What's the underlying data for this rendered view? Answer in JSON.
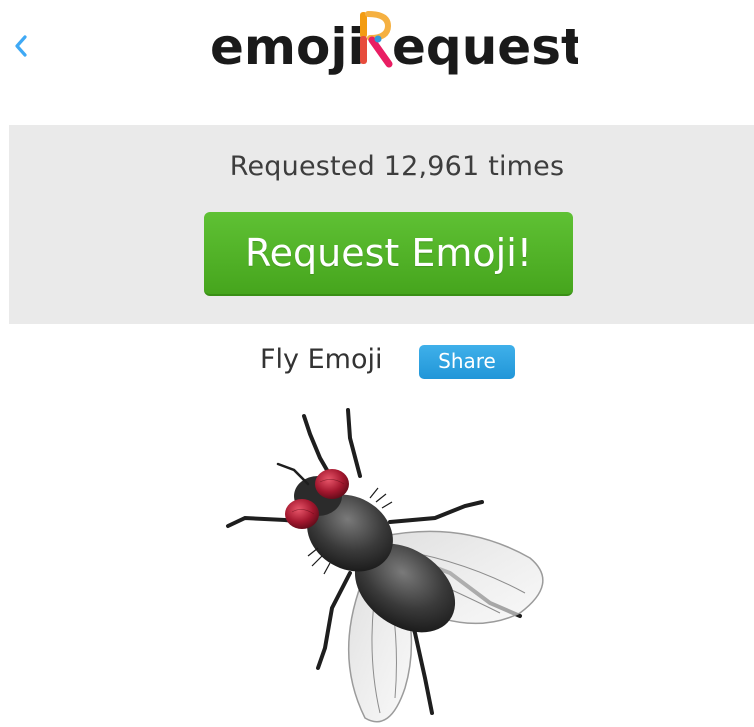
{
  "header": {
    "back_icon": "chevron-left-icon",
    "logo": {
      "part1": "emoji",
      "part2": "equest",
      "colors": {
        "text": "#1a1a1a",
        "r_orange": "#f39c12",
        "r_red": "#e74c3c",
        "r_pink": "#e91e63",
        "r_blue": "#3498db"
      }
    }
  },
  "request_panel": {
    "count_text": "Requested 12,961 times",
    "button_label": "Request Emoji!"
  },
  "emoji": {
    "title": "Fly Emoji",
    "share_label": "Share",
    "image": "fly-image"
  },
  "colors": {
    "accent_green": "#4cb026",
    "accent_blue": "#2ba3e2",
    "back_icon": "#3fa9f5",
    "panel_bg": "#eaeaea"
  }
}
